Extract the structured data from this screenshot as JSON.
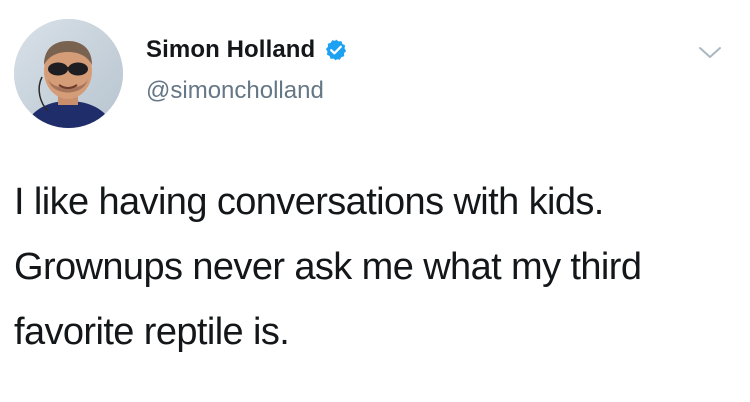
{
  "author": {
    "display_name": "Simon Holland",
    "handle": "@simoncholland",
    "verified": true,
    "avatar": "profile-photo-man-with-sunglasses"
  },
  "tweet": {
    "lines": [
      "I like having conversations with kids.",
      "Grownups never ask me what my third",
      "favorite reptile is."
    ]
  },
  "icons": {
    "verified": "verified-badge-icon",
    "menu": "chevron-down-icon"
  },
  "colors": {
    "text": "#14171a",
    "secondary_text": "#657786",
    "verified_blue": "#1da1f2",
    "background": "#ffffff"
  }
}
